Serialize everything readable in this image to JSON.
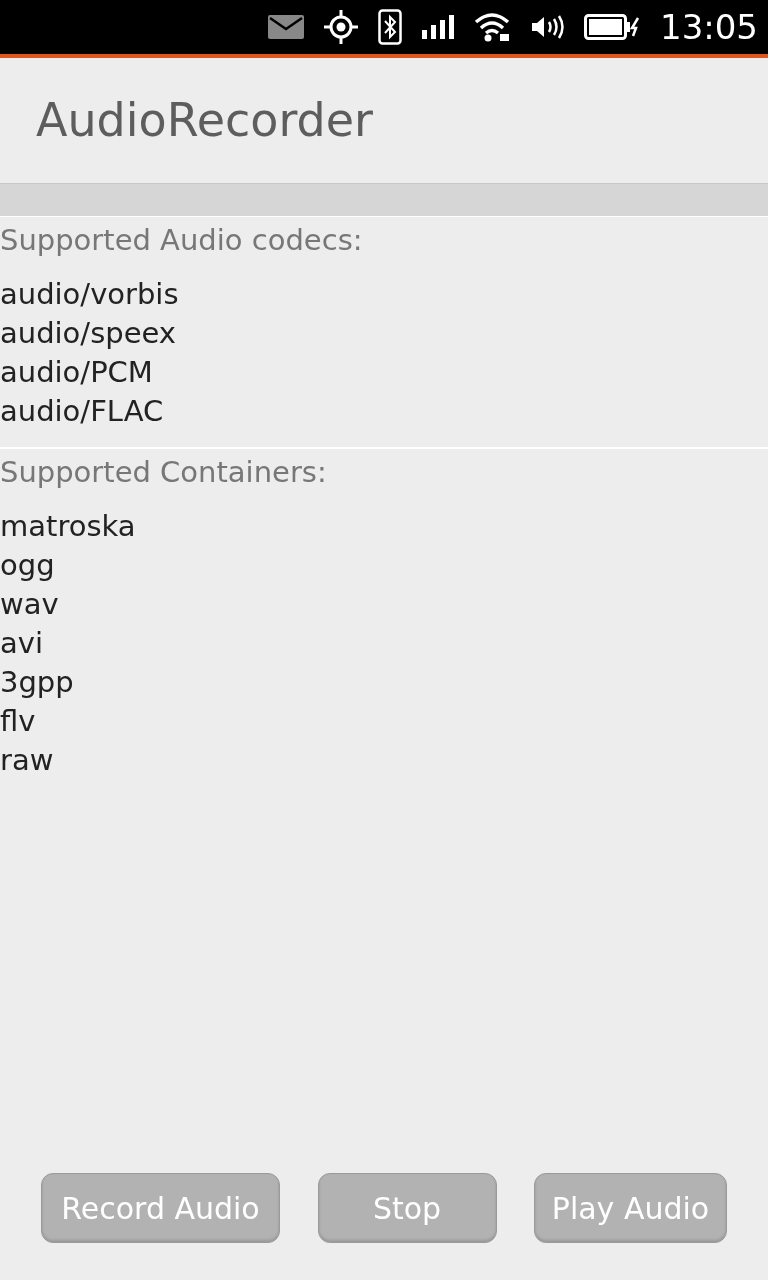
{
  "status_bar": {
    "time": "13:05"
  },
  "header": {
    "title": "AudioRecorder"
  },
  "sections": [
    {
      "heading": "Supported Audio codecs:",
      "items": [
        "audio/vorbis",
        "audio/speex",
        "audio/PCM",
        "audio/FLAC"
      ]
    },
    {
      "heading": "Supported Containers:",
      "items": [
        "matroska",
        "ogg",
        "wav",
        "avi",
        "3gpp",
        "flv",
        "raw"
      ]
    }
  ],
  "buttons": [
    "Record Audio",
    "Stop",
    "Play Audio"
  ]
}
